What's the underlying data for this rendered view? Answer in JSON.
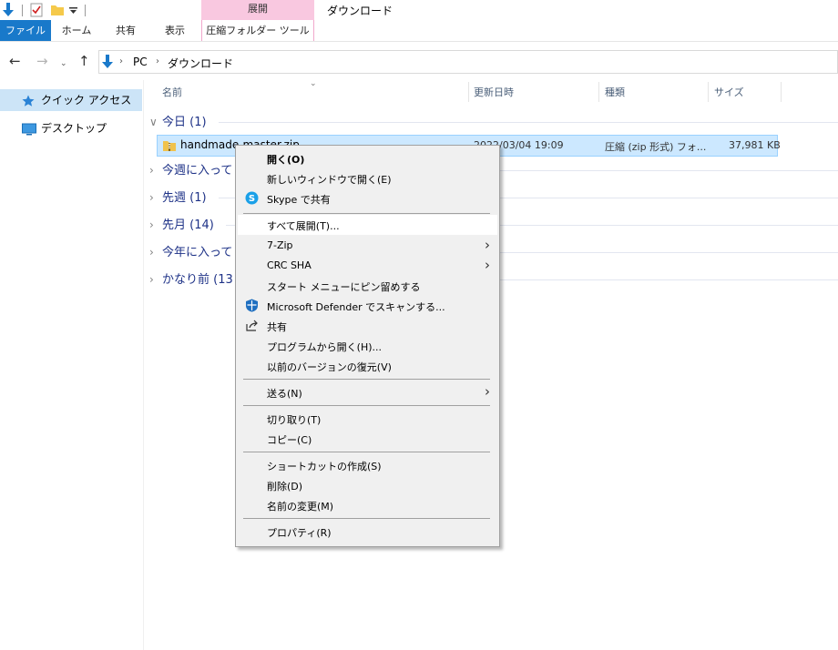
{
  "window": {
    "title": "ダウンロード",
    "context_tab_header": "展開"
  },
  "ribbon": {
    "file": "ファイル",
    "home": "ホーム",
    "share": "共有",
    "view": "表示",
    "compressed_tools": "圧縮フォルダー ツール"
  },
  "address": {
    "pc": "PC",
    "downloads": "ダウンロード"
  },
  "nav_pane": {
    "quick_access": "クイック アクセス",
    "desktop": "デスクトップ"
  },
  "columns": {
    "name": "名前",
    "modified": "更新日時",
    "type": "種類",
    "size": "サイズ"
  },
  "groups": {
    "today": "今日 (1)",
    "this_week": "今週に入って",
    "last_week": "先週 (1)",
    "last_month": "先月 (14)",
    "this_year": "今年に入って",
    "long_ago": "かなり前 (13"
  },
  "file": {
    "name": "handmade-master.zip",
    "modified": "2022/03/04 19:09",
    "type": "圧縮 (zip 形式) フォ...",
    "size": "37,981 KB"
  },
  "context_menu": {
    "open": "開く(O)",
    "open_new_window": "新しいウィンドウで開く(E)",
    "skype_share": "Skype で共有",
    "extract_all": "すべて展開(T)...",
    "seven_zip": "7-Zip",
    "crc_sha": "CRC SHA",
    "pin_start": "スタート メニューにピン留めする",
    "defender_scan": "Microsoft Defender でスキャンする...",
    "share": "共有",
    "open_with": "プログラムから開く(H)...",
    "restore_versions": "以前のバージョンの復元(V)",
    "send_to": "送る(N)",
    "cut": "切り取り(T)",
    "copy": "コピー(C)",
    "create_shortcut": "ショートカットの作成(S)",
    "delete": "削除(D)",
    "rename": "名前の変更(M)",
    "properties": "プロパティ(R)"
  },
  "colors": {
    "accent": "#1979ca",
    "selection": "#cce8ff",
    "group_text": "#1e3287",
    "context_tab": "#f9c8e0"
  }
}
